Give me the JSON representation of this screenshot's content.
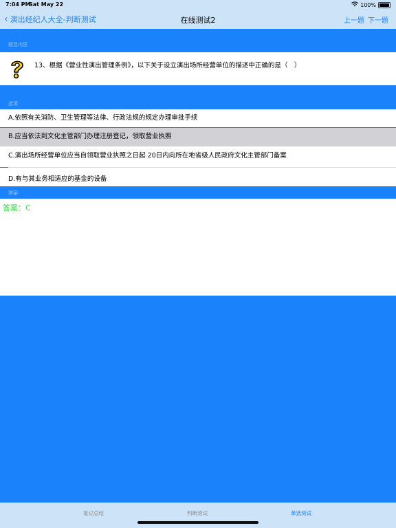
{
  "status": {
    "time": "7:04 PM",
    "date": "Sat May 22",
    "wifi_icon": "wifi-icon",
    "battery": "100%"
  },
  "nav": {
    "back_label": "演出经纪人大全-判断测试",
    "title": "在线测试2",
    "prev_label": "上一题",
    "next_label": "下一题"
  },
  "question": {
    "section_label": "题目内容",
    "icon": "question-mark-icon",
    "text": "13、根据《营业性演出管理条例》，以下关于设立演出场所经营单位的描述中正确的是（　）"
  },
  "options": {
    "section_label": "选项",
    "items": [
      {
        "label": "A.依照有关消防、卫生管理等法律、行政法规的规定办理审批手续",
        "selected": false
      },
      {
        "label": "B.应当依法到文化主管部门办理注册登记，领取营业执照",
        "selected": true
      },
      {
        "label": "C.演出场所经营单位应当自领取营业执照之日起 20日内向所在地省级人民政府文化主管部门备案",
        "selected": false
      },
      {
        "label": "D.有与其业务相适应的基金的设备",
        "selected": false
      }
    ]
  },
  "answer": {
    "section_label": "答案",
    "text": "答案：C"
  },
  "tabs": [
    {
      "label": "笔记总结",
      "active": false
    },
    {
      "label": "判断测试",
      "active": false
    },
    {
      "label": "单选测试",
      "active": true
    }
  ],
  "colors": {
    "accent": "#1a82fb",
    "bar": "#cde4f8",
    "answer": "#3ed84a",
    "selected_row": "#d1d1d6"
  }
}
